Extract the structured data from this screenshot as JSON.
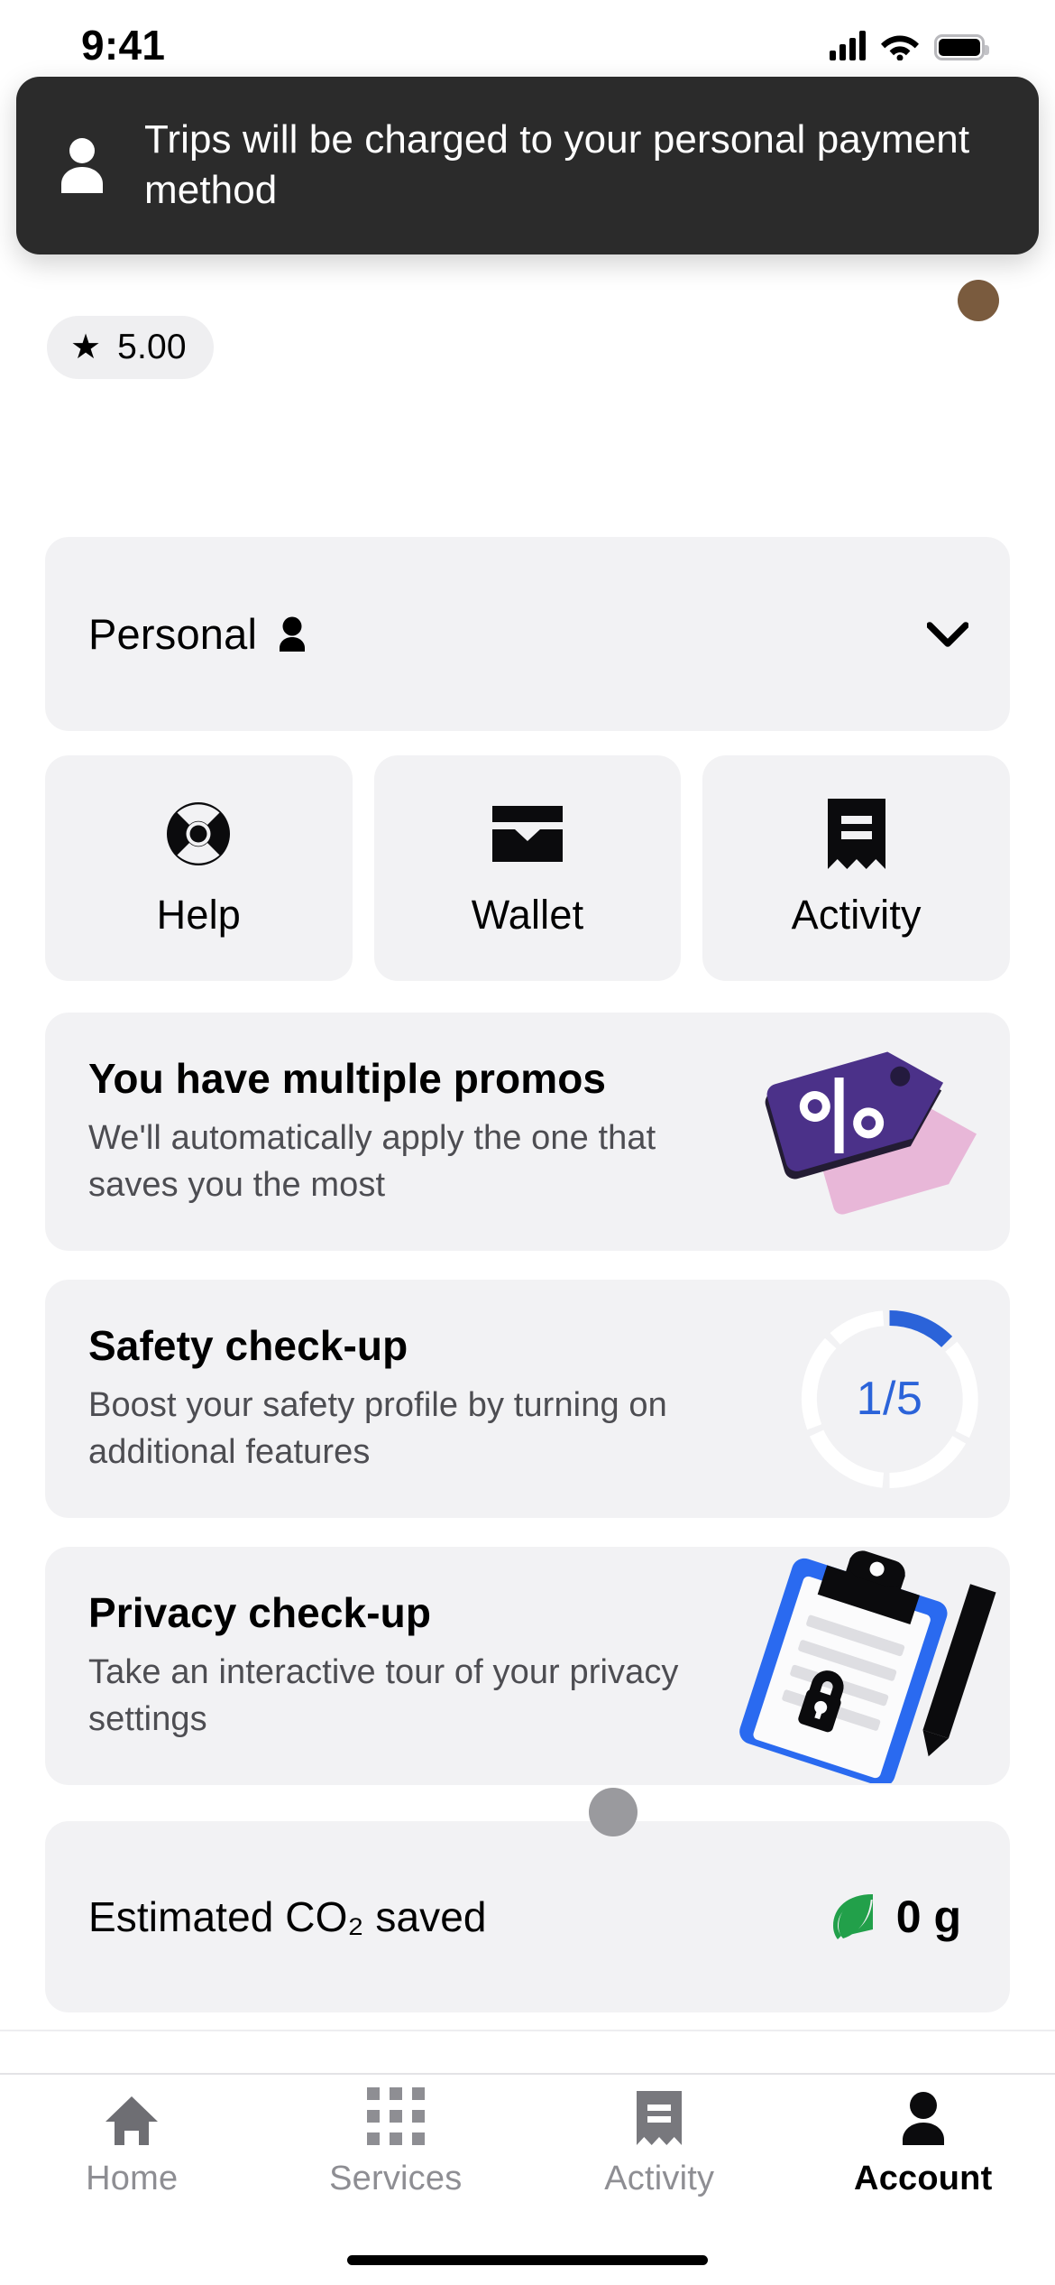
{
  "status_bar": {
    "time": "9:41",
    "icons": [
      "cellular-signal-icon",
      "wifi-icon",
      "battery-icon"
    ]
  },
  "toast": {
    "icon": "person-icon",
    "message": "Trips will be charged to your personal payment method"
  },
  "header": {
    "rating_star": "★",
    "rating_value": "5.00",
    "avatar": "user-avatar"
  },
  "account_switcher": {
    "label": "Personal",
    "person_icon": "person-icon",
    "chevron": "chevron-down-icon"
  },
  "quick_tiles": [
    {
      "label": "Help",
      "icon": "lifebuoy-icon"
    },
    {
      "label": "Wallet",
      "icon": "wallet-icon"
    },
    {
      "label": "Activity",
      "icon": "receipt-icon"
    }
  ],
  "cards": {
    "promos": {
      "title": "You have multiple promos",
      "subtitle": "We'll automatically apply the one that saves you the most",
      "art": "price-tags-illustration"
    },
    "safety": {
      "title": "Safety check-up",
      "subtitle": "Boost your safety profile by turning on additional features",
      "progress_text": "1/5",
      "progress_completed": 1,
      "progress_total": 5,
      "art": "progress-ring"
    },
    "privacy": {
      "title": "Privacy check-up",
      "subtitle": "Take an interactive tour of your privacy settings",
      "art": "clipboard-lock-pen-illustration"
    },
    "co2": {
      "label": "Estimated CO₂ saved",
      "value": "0 g",
      "icon": "leaf-icon"
    }
  },
  "bottom_nav": {
    "items": [
      {
        "label": "Home",
        "icon": "home-icon",
        "active": false
      },
      {
        "label": "Services",
        "icon": "grid-icon",
        "active": false
      },
      {
        "label": "Activity",
        "icon": "receipt-icon",
        "active": false
      },
      {
        "label": "Account",
        "icon": "person-icon",
        "active": true
      }
    ]
  },
  "colors": {
    "card_background": "#f2f2f4",
    "toast_background": "#2b2b2b",
    "accent_blue": "#2b63d9",
    "promo_purple": "#4b3189",
    "promo_pink": "#e8b7d8",
    "leaf_green": "#22a04a",
    "inactive_gray": "#8e8e93"
  }
}
